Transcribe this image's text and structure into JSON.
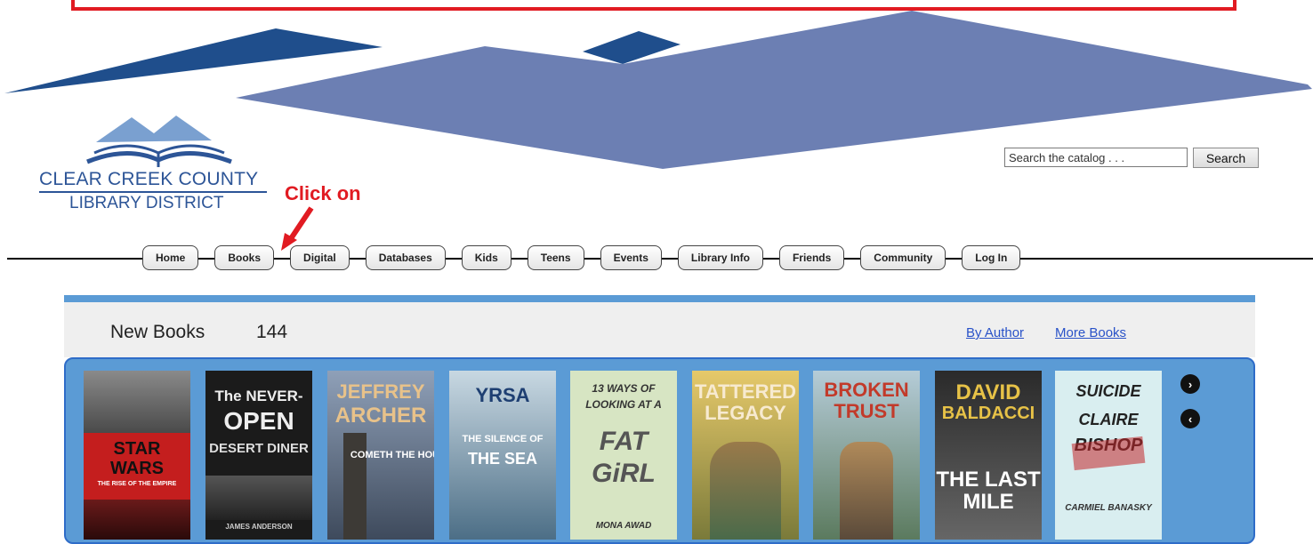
{
  "library": {
    "name_line1": "CLEAR CREEK COUNTY",
    "name_line2": "LIBRARY DISTRICT"
  },
  "annotation": {
    "text": "Click on"
  },
  "search": {
    "placeholder": "Search the catalog . . .",
    "button_label": "Search"
  },
  "nav": {
    "items": [
      {
        "label": "Home"
      },
      {
        "label": "Books"
      },
      {
        "label": "Digital"
      },
      {
        "label": "Databases"
      },
      {
        "label": "Kids"
      },
      {
        "label": "Teens"
      },
      {
        "label": "Events"
      },
      {
        "label": "Library Info"
      },
      {
        "label": "Friends"
      },
      {
        "label": "Community"
      },
      {
        "label": "Log In"
      }
    ]
  },
  "new_books": {
    "title": "New Books",
    "count": "144",
    "by_author_link": "By Author",
    "more_books_link": "More Books",
    "books": [
      {
        "cover_top": "STAR",
        "cover_mid": "WARS",
        "cover_sub": "THE RISE OF THE EMPIRE"
      },
      {
        "cover_top": "The NEVER-",
        "cover_mid": "OPEN",
        "cover_sub": "DESERT DINER",
        "author": "JAMES ANDERSON"
      },
      {
        "cover_top": "JEFFREY",
        "cover_mid": "ARCHER",
        "cover_sub": "COMETH THE HOUR"
      },
      {
        "cover_top": "YRSA",
        "cover_mid": "THE SILENCE OF",
        "cover_sub": "THE SEA"
      },
      {
        "cover_top": "13 WAYS OF",
        "cover_mid": "LOOKING AT A",
        "cover_sub": "FAT GiRL",
        "author": "MONA AWAD"
      },
      {
        "cover_top": "TATTERED",
        "cover_mid": "LEGACY"
      },
      {
        "cover_top": "BROKEN",
        "cover_mid": "TRUST"
      },
      {
        "cover_top": "DAVID",
        "cover_mid": "BALDACCI",
        "cover_sub": "THE LAST MILE"
      },
      {
        "cover_top": "SUICIDE",
        "cover_mid": "CLAIRE",
        "cover_sub": "BISHOP",
        "author": "CARMIEL BANASKY"
      }
    ]
  },
  "colors": {
    "brand_blue": "#2d5597",
    "header_shape_dark": "#1f4e8c",
    "header_shape_light": "#6c7fb3",
    "annotation_red": "#e11b22",
    "carousel_bg": "#5b9bd5",
    "link_blue": "#2952c8"
  },
  "icons": {
    "next": "chevron-right-icon",
    "prev": "chevron-left-icon"
  }
}
